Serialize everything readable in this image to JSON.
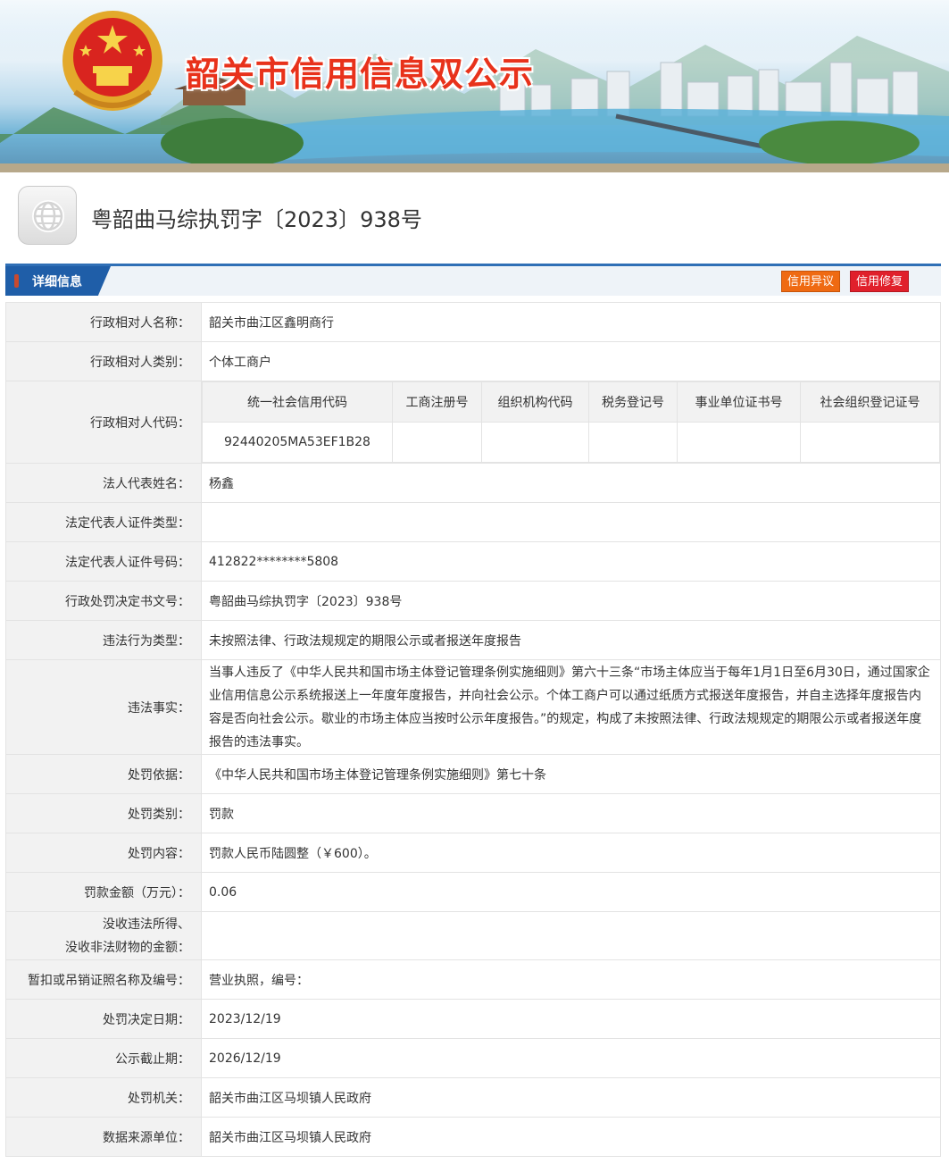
{
  "banner": {
    "title": "韶关市信用信息双公示"
  },
  "page": {
    "title": "粤韶曲马综执罚字〔2023〕938号"
  },
  "section": {
    "label": "详细信息",
    "dissent_button": "信用异议",
    "repair_button": "信用修复"
  },
  "fields": {
    "name_label": "行政相对人名称：",
    "name_value": "韶关市曲江区鑫明商行",
    "category_label": "行政相对人类别：",
    "category_value": "个体工商户",
    "code_label": "行政相对人代码：",
    "code_headers": [
      "统一社会信用代码",
      "工商注册号",
      "组织机构代码",
      "税务登记号",
      "事业单位证书号",
      "社会组织登记证号"
    ],
    "code_values": [
      "92440205MA53EF1B28",
      "",
      "",
      "",
      "",
      ""
    ],
    "legal_name_label": "法人代表姓名：",
    "legal_name_value": "杨鑫",
    "id_type_label": "法定代表人证件类型：",
    "id_type_value": "",
    "id_number_label": "法定代表人证件号码：",
    "id_number_value": "412822********5808",
    "doc_number_label": "行政处罚决定书文号：",
    "doc_number_value": "粤韶曲马综执罚字〔2023〕938号",
    "violation_type_label": "违法行为类型：",
    "violation_type_value": "未按照法律、行政法规规定的期限公示或者报送年度报告",
    "facts_label": "违法事实：",
    "facts_value": "当事人违反了《中华人民共和国市场主体登记管理条例实施细则》第六十三条“市场主体应当于每年1月1日至6月30日，通过国家企业信用信息公示系统报送上一年度年度报告，并向社会公示。个体工商户可以通过纸质方式报送年度报告，并自主选择年度报告内容是否向社会公示。歇业的市场主体应当按时公示年度报告。”的规定，构成了未按照法律、行政法规规定的期限公示或者报送年度报告的违法事实。",
    "basis_label": "处罚依据：",
    "basis_value": "《中华人民共和国市场主体登记管理条例实施细则》第七十条",
    "penalty_type_label": "处罚类别：",
    "penalty_type_value": "罚款",
    "penalty_content_label": "处罚内容：",
    "penalty_content_value": "罚款人民币陆圆整（￥600）。",
    "amount_label": "罚款金额（万元）：",
    "amount_value": "0.06",
    "confiscation_label_1": "没收违法所得、",
    "confiscation_label_2": "没收非法财物的金额：",
    "confiscation_value": "",
    "license_label": "暂扣或吊销证照名称及编号：",
    "license_value": "营业执照，编号：",
    "decision_date_label": "处罚决定日期：",
    "decision_date_value": "2023/12/19",
    "expiry_label": "公示截止期：",
    "expiry_value": "2026/12/19",
    "authority_label": "处罚机关：",
    "authority_value": "韶关市曲江区马坝镇人民政府",
    "source_label": "数据来源单位：",
    "source_value": "韶关市曲江区马坝镇人民政府"
  },
  "colors": {
    "accent_blue": "#1f5ea8",
    "title_red": "#e8321b",
    "dissent_orange": "#ef6a12",
    "repair_red": "#e0202b"
  },
  "icons": [
    "national-emblem-icon",
    "globe-icon"
  ]
}
